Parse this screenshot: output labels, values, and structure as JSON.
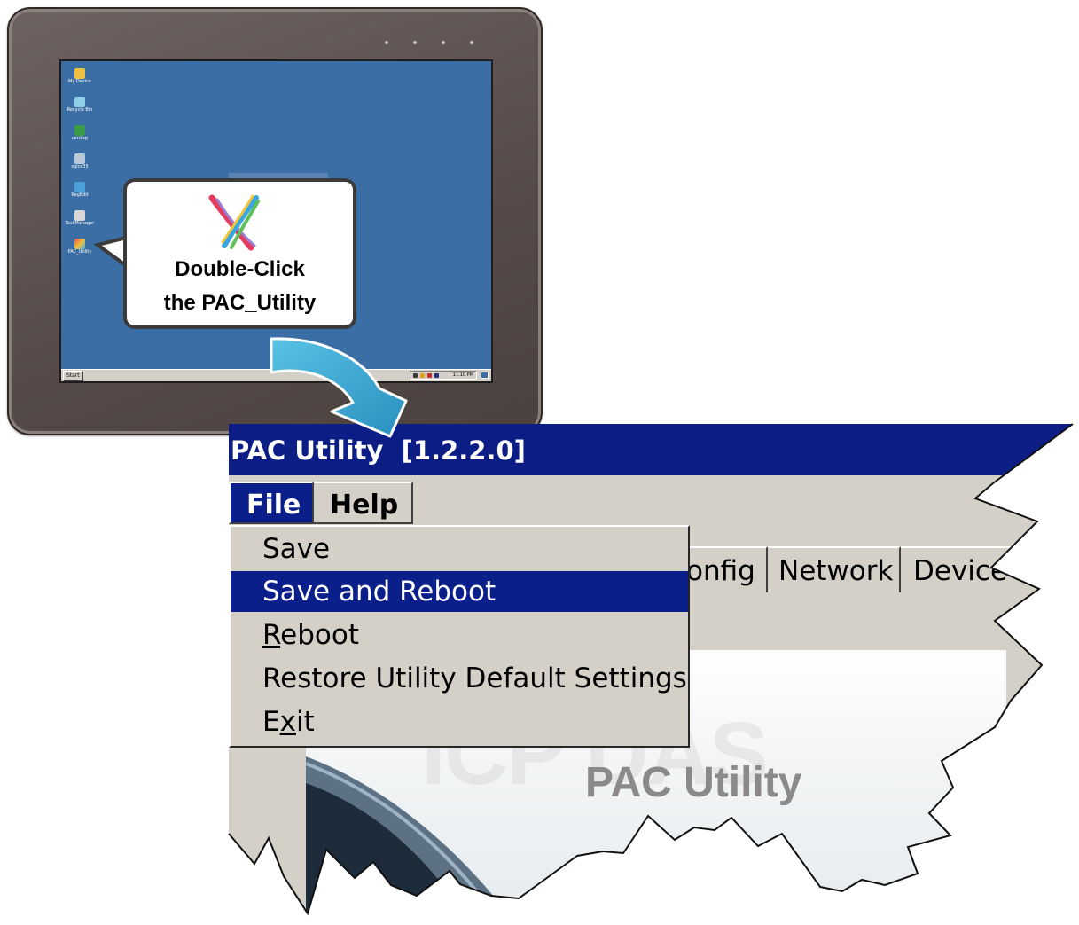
{
  "desktop": {
    "icons": [
      "My Device",
      "Recycle Bin",
      "cerdisp",
      "sqlce35",
      "RegEdit",
      "TaskManager",
      "PAC_Utility"
    ],
    "taskbar": {
      "start_label": "Start",
      "clock": "11:10 PM"
    }
  },
  "callout": {
    "line1": "Double-Click",
    "line2": "the PAC_Utility",
    "icon": "pac-utility-icon"
  },
  "app": {
    "title": "PAC Utility  [1.2.2.0]",
    "menu": {
      "file": "File",
      "help": "Help"
    },
    "file_menu": {
      "items": [
        {
          "label": "Save"
        },
        {
          "label": "Save and Reboot",
          "highlighted": true
        },
        {
          "before": "",
          "mnemonic": "R",
          "after": "eboot"
        },
        {
          "label": "Restore Utility Default Settings"
        },
        {
          "before": "E",
          "mnemonic": "x",
          "after": "it"
        }
      ]
    },
    "tabs": [
      "onfig",
      "Network",
      "Device"
    ],
    "splash": {
      "title": "PAC Utility",
      "watermark": "ICP DAS"
    }
  },
  "colors": {
    "title_bar": "#0c1e85",
    "menu_highlight": "#0a1f8a",
    "desktop_bg": "#3a6ea5",
    "arrow": "#3aa7d0",
    "device_frame": "#5a4f4c"
  }
}
